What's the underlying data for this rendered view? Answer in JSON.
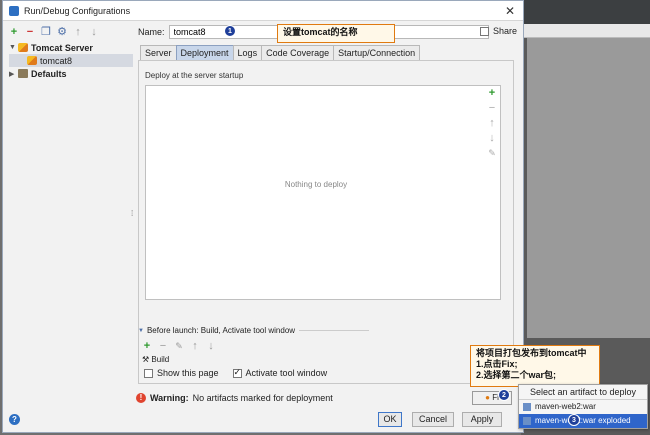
{
  "window": {
    "title": "Run/Debug Configurations"
  },
  "toolbar": {
    "icons": [
      "add-icon",
      "remove-icon",
      "copy-icon",
      "settings-icon",
      "move-up-icon",
      "move-down-icon"
    ]
  },
  "tree": {
    "group": "Tomcat Server",
    "child": "tomcat8",
    "defaults": "Defaults"
  },
  "name": {
    "label": "Name:",
    "value": "tomcat8"
  },
  "share": {
    "label": "Share"
  },
  "tabs": [
    "Server",
    "Deployment",
    "Logs",
    "Code Coverage",
    "Startup/Connection"
  ],
  "active_tab": "Deployment",
  "deployment": {
    "section_label": "Deploy at the server startup",
    "empty_text": "Nothing to deploy"
  },
  "before_launch": {
    "label": "Before launch: Build, Activate tool window",
    "item": "Build"
  },
  "checks": {
    "show_page": {
      "label": "Show this page",
      "checked": false
    },
    "activate_tool": {
      "label": "Activate tool window",
      "checked": true
    }
  },
  "warning": {
    "bold": "Warning:",
    "text": "No artifacts marked for deployment"
  },
  "buttons": {
    "fix": "Fi",
    "ok": "OK",
    "cancel": "Cancel",
    "apply": "Apply"
  },
  "help": "?",
  "annotations": {
    "a1": "设置tomcat的名称",
    "a2_line1": "将项目打包发布到tomcat中",
    "a2_line2": "1.点击Fix;",
    "a2_line3": "2.选择第二个war包;"
  },
  "badges": {
    "b1": "1",
    "b2": "2",
    "b3": "3"
  },
  "popup": {
    "title": "Select an artifact to deploy",
    "items": [
      "maven-web2:war",
      "maven-web2:war exploded"
    ]
  },
  "colors": {
    "accent": "#2f65ca",
    "annotation_border": "#e07a10",
    "badge": "#1f3f9a"
  }
}
